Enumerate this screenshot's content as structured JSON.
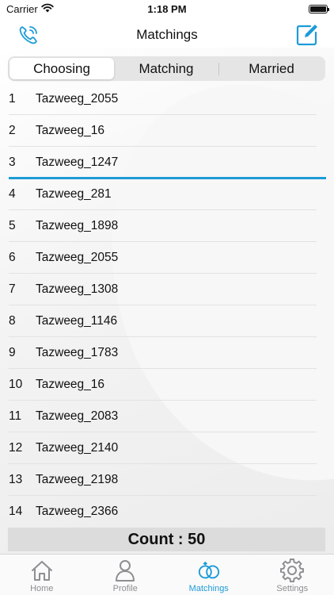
{
  "status": {
    "carrier": "Carrier",
    "time": "1:18 PM"
  },
  "header": {
    "title": "Matchings",
    "left_icon": "phone-icon",
    "right_icon": "edit-icon"
  },
  "tabs": [
    {
      "label": "Choosing",
      "active": true
    },
    {
      "label": "Matching",
      "active": false
    },
    {
      "label": "Married",
      "active": false
    }
  ],
  "items": [
    {
      "num": "1",
      "name": "Tazweeg_2055"
    },
    {
      "num": "2",
      "name": "Tazweeg_16"
    },
    {
      "num": "3",
      "name": "Tazweeg_1247"
    },
    {
      "num": "4",
      "name": "Tazweeg_281"
    },
    {
      "num": "5",
      "name": "Tazweeg_1898"
    },
    {
      "num": "6",
      "name": "Tazweeg_2055"
    },
    {
      "num": "7",
      "name": "Tazweeg_1308"
    },
    {
      "num": "8",
      "name": "Tazweeg_1146"
    },
    {
      "num": "9",
      "name": "Tazweeg_1783"
    },
    {
      "num": "10",
      "name": "Tazweeg_16"
    },
    {
      "num": "11",
      "name": "Tazweeg_2083"
    },
    {
      "num": "12",
      "name": "Tazweeg_2140"
    },
    {
      "num": "13",
      "name": "Tazweeg_2198"
    },
    {
      "num": "14",
      "name": "Tazweeg_2366"
    }
  ],
  "count_label": "Count : 50",
  "tabbar": [
    {
      "label": "Home",
      "icon": "home-icon"
    },
    {
      "label": "Profile",
      "icon": "profile-icon"
    },
    {
      "label": "Matchings",
      "icon": "rings-icon"
    },
    {
      "label": "Settings",
      "icon": "gear-icon"
    }
  ],
  "colors": {
    "accent": "#1d9bd8",
    "inactive": "#8e8e93"
  }
}
